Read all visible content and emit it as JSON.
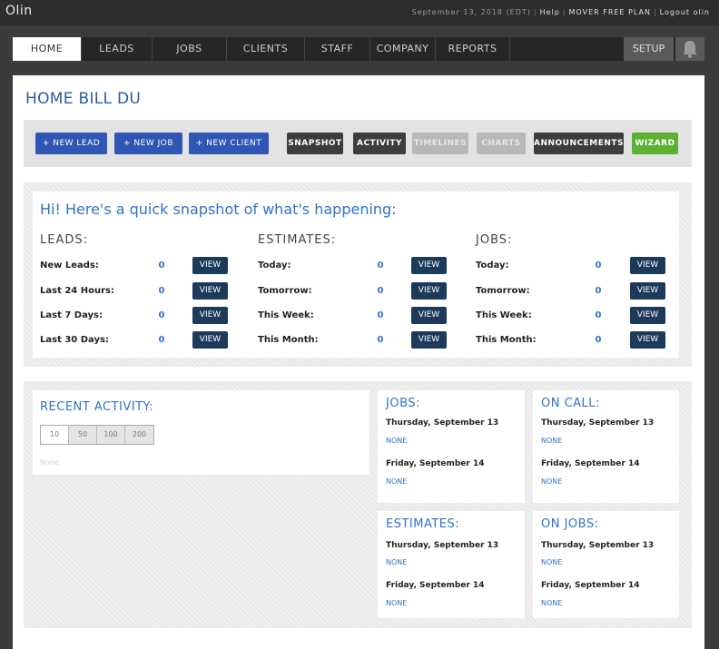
{
  "topbar": {
    "brand": "Olin",
    "date": "September 13, 2018 (EDT)",
    "help": "Help",
    "plan": "MOVER FREE PLAN",
    "logout": "Logout olin"
  },
  "nav": {
    "tabs": [
      "HOME",
      "LEADS",
      "JOBS",
      "CLIENTS",
      "STAFF",
      "COMPANY",
      "REPORTS"
    ],
    "setup": "SETUP"
  },
  "page": {
    "title": "HOME BILL DU"
  },
  "toolbar": {
    "new_lead": "+ NEW LEAD",
    "new_job": "+ NEW JOB",
    "new_client": "+ NEW CLIENT",
    "snapshot": "SNAPSHOT",
    "activity": "ACTIVITY",
    "timelines": "TIMELINES",
    "charts": "CHARTS",
    "announcements": "ANNOUNCEMENTS",
    "wizard": "WIZARD"
  },
  "snapshot": {
    "title": "Hi! Here's a quick snapshot of what's happening:",
    "view_label": "VIEW",
    "columns": [
      {
        "heading": "LEADS:",
        "rows": [
          {
            "label": "New Leads:",
            "value": "0"
          },
          {
            "label": "Last 24 Hours:",
            "value": "0"
          },
          {
            "label": "Last 7 Days:",
            "value": "0"
          },
          {
            "label": "Last 30 Days:",
            "value": "0"
          }
        ]
      },
      {
        "heading": "ESTIMATES:",
        "rows": [
          {
            "label": "Today:",
            "value": "0"
          },
          {
            "label": "Tomorrow:",
            "value": "0"
          },
          {
            "label": "This Week:",
            "value": "0"
          },
          {
            "label": "This Month:",
            "value": "0"
          }
        ]
      },
      {
        "heading": "JOBS:",
        "rows": [
          {
            "label": "Today:",
            "value": "0"
          },
          {
            "label": "Tomorrow:",
            "value": "0"
          },
          {
            "label": "This Week:",
            "value": "0"
          },
          {
            "label": "This Month:",
            "value": "0"
          }
        ]
      }
    ]
  },
  "recent_activity": {
    "title": "RECENT ACTIVITY:",
    "page_sizes": [
      "10",
      "50",
      "100",
      "200"
    ],
    "empty": "None"
  },
  "schedule": {
    "jobs": {
      "title": "JOBS:",
      "days": [
        {
          "date": "Thursday, September 13",
          "value": "NONE"
        },
        {
          "date": "Friday, September 14",
          "value": "NONE"
        }
      ]
    },
    "on_call": {
      "title": "ON CALL:",
      "days": [
        {
          "date": "Thursday, September 13",
          "value": "NONE"
        },
        {
          "date": "Friday, September 14",
          "value": "NONE"
        }
      ]
    },
    "estimates": {
      "title": "ESTIMATES:",
      "days": [
        {
          "date": "Thursday, September 13",
          "value": "NONE"
        },
        {
          "date": "Friday, September 14",
          "value": "NONE"
        }
      ]
    },
    "on_jobs": {
      "title": "ON JOBS:",
      "days": [
        {
          "date": "Thursday, September 13",
          "value": "NONE"
        },
        {
          "date": "Friday, September 14",
          "value": "NONE"
        }
      ]
    }
  },
  "colors": {
    "accent": "#2f73c9",
    "title": "#2a5d9f",
    "button_blue": "#3056b4",
    "button_dark": "#3d3d3d",
    "view_button": "#1e3a5a",
    "wizard_green": "#5cb133"
  },
  "icons": {
    "bell": "bell-icon"
  }
}
